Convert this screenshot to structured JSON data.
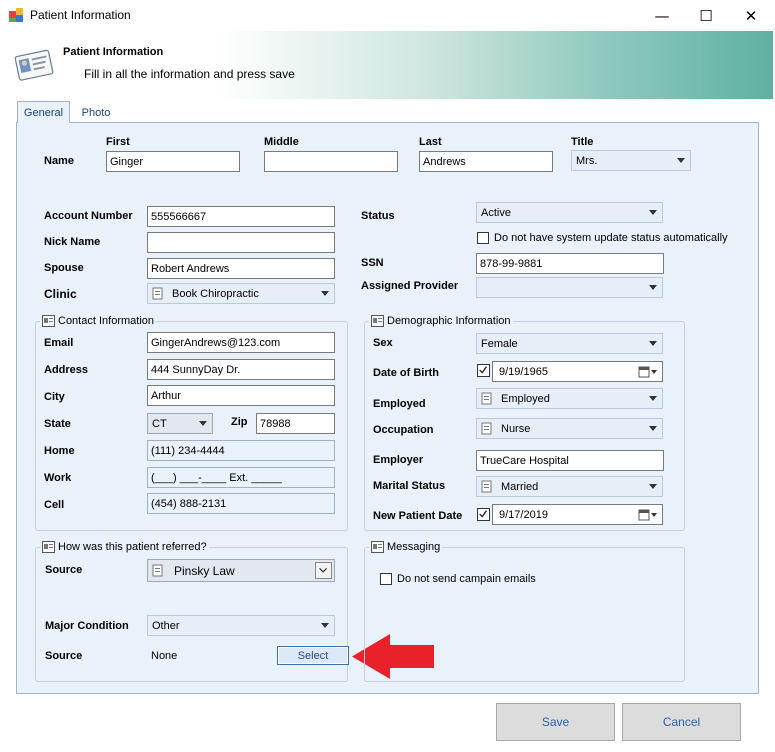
{
  "window": {
    "title": "Patient Information",
    "minimize": "—",
    "maximize": "☐",
    "close": "✕"
  },
  "header": {
    "title": "Patient Information",
    "subtitle": "Fill in all the information and press save"
  },
  "tabs": [
    {
      "label": "General"
    },
    {
      "label": "Photo"
    }
  ],
  "name": {
    "label": "Name",
    "first_label": "First",
    "first": "Ginger",
    "middle_label": "Middle",
    "middle": "",
    "last_label": "Last",
    "last": "Andrews",
    "title_label": "Title",
    "title": "Mrs."
  },
  "account": {
    "account_number_label": "Account Number",
    "account_number": "555566667",
    "nick_name_label": "Nick Name",
    "nick_name": "",
    "spouse_label": "Spouse",
    "spouse": "Robert Andrews",
    "clinic_label": "Clinic",
    "clinic": "Book Chiropractic"
  },
  "status": {
    "status_label": "Status",
    "status": "Active",
    "no_auto_update": "Do not have system update status automatically",
    "ssn_label": "SSN",
    "ssn": "878-99-9881",
    "provider_label": "Assigned Provider",
    "provider": ""
  },
  "contact": {
    "group_title": "Contact Information",
    "email_label": "Email",
    "email": "GingerAndrews@123.com",
    "address_label": "Address",
    "address": "444 SunnyDay Dr.",
    "city_label": "City",
    "city": "Arthur",
    "state_label": "State",
    "state": "CT",
    "zip_label": "Zip",
    "zip": "78988",
    "home_label": "Home",
    "home": "(111) 234-4444",
    "work_label": "Work",
    "work": "(___) ___-____ Ext. _____",
    "cell_label": "Cell",
    "cell": "(454) 888-2131"
  },
  "demographic": {
    "group_title": "Demographic Information",
    "sex_label": "Sex",
    "sex": "Female",
    "dob_label": "Date of Birth",
    "dob": "9/19/1965",
    "employed_label": "Employed",
    "employed": "Employed",
    "occupation_label": "Occupation",
    "occupation": "Nurse",
    "employer_label": "Employer",
    "employer": "TrueCare Hospital",
    "marital_label": "Marital Status",
    "marital": "Married",
    "new_patient_label": "New Patient Date",
    "new_patient": "9/17/2019"
  },
  "referral": {
    "group_title": "How was this patient referred?",
    "source_label": "Source",
    "source": "Pinsky Law",
    "major_condition_label": "Major Condition",
    "major_condition": "Other",
    "source2_label": "Source",
    "source2": "None",
    "select_label": "Select"
  },
  "messaging": {
    "group_title": "Messaging",
    "no_campaign": "Do not send campain emails"
  },
  "footer": {
    "save": "Save",
    "cancel": "Cancel"
  },
  "colors": {
    "accent": "#5fb19e",
    "panel": "#e9f1fa",
    "arrow": "#e8212a"
  }
}
